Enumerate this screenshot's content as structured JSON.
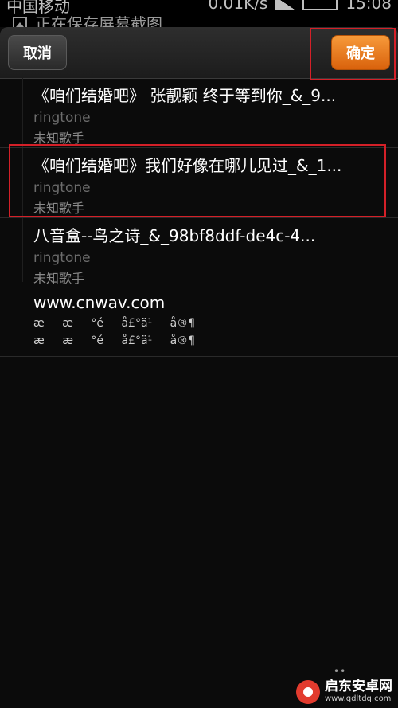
{
  "status_bar": {
    "carrier": "中国移动",
    "stats": "0.01K/s",
    "time": "15:08",
    "notification": "正在保存屏幕截图"
  },
  "action_bar": {
    "cancel_label": "取消",
    "confirm_label": "确定"
  },
  "list": {
    "items": [
      {
        "title": "《咱们结婚吧》 张靓颖 终于等到你_&_9...",
        "subtitle": "ringtone",
        "artist": "未知歌手"
      },
      {
        "title": "《咱们结婚吧》我们好像在哪儿见过_&_1...",
        "subtitle": "ringtone",
        "artist": "未知歌手"
      },
      {
        "title": "八音盒--鸟之诗_&_98bf8ddf-de4c-4...",
        "subtitle": "ringtone",
        "artist": "未知歌手"
      },
      {
        "title": "www.cnwav.com",
        "subtitle": "æ æ °é å£°ä¹ å®¶",
        "artist": "æ æ °é å£°ä¹ å®¶"
      }
    ]
  },
  "watermark": {
    "name": "启东安卓网",
    "url": "www.qdltdq.com"
  },
  "colors": {
    "confirm_accent": "#e8781e",
    "highlight_red": "#d42028",
    "background": "#0b0b0b"
  }
}
